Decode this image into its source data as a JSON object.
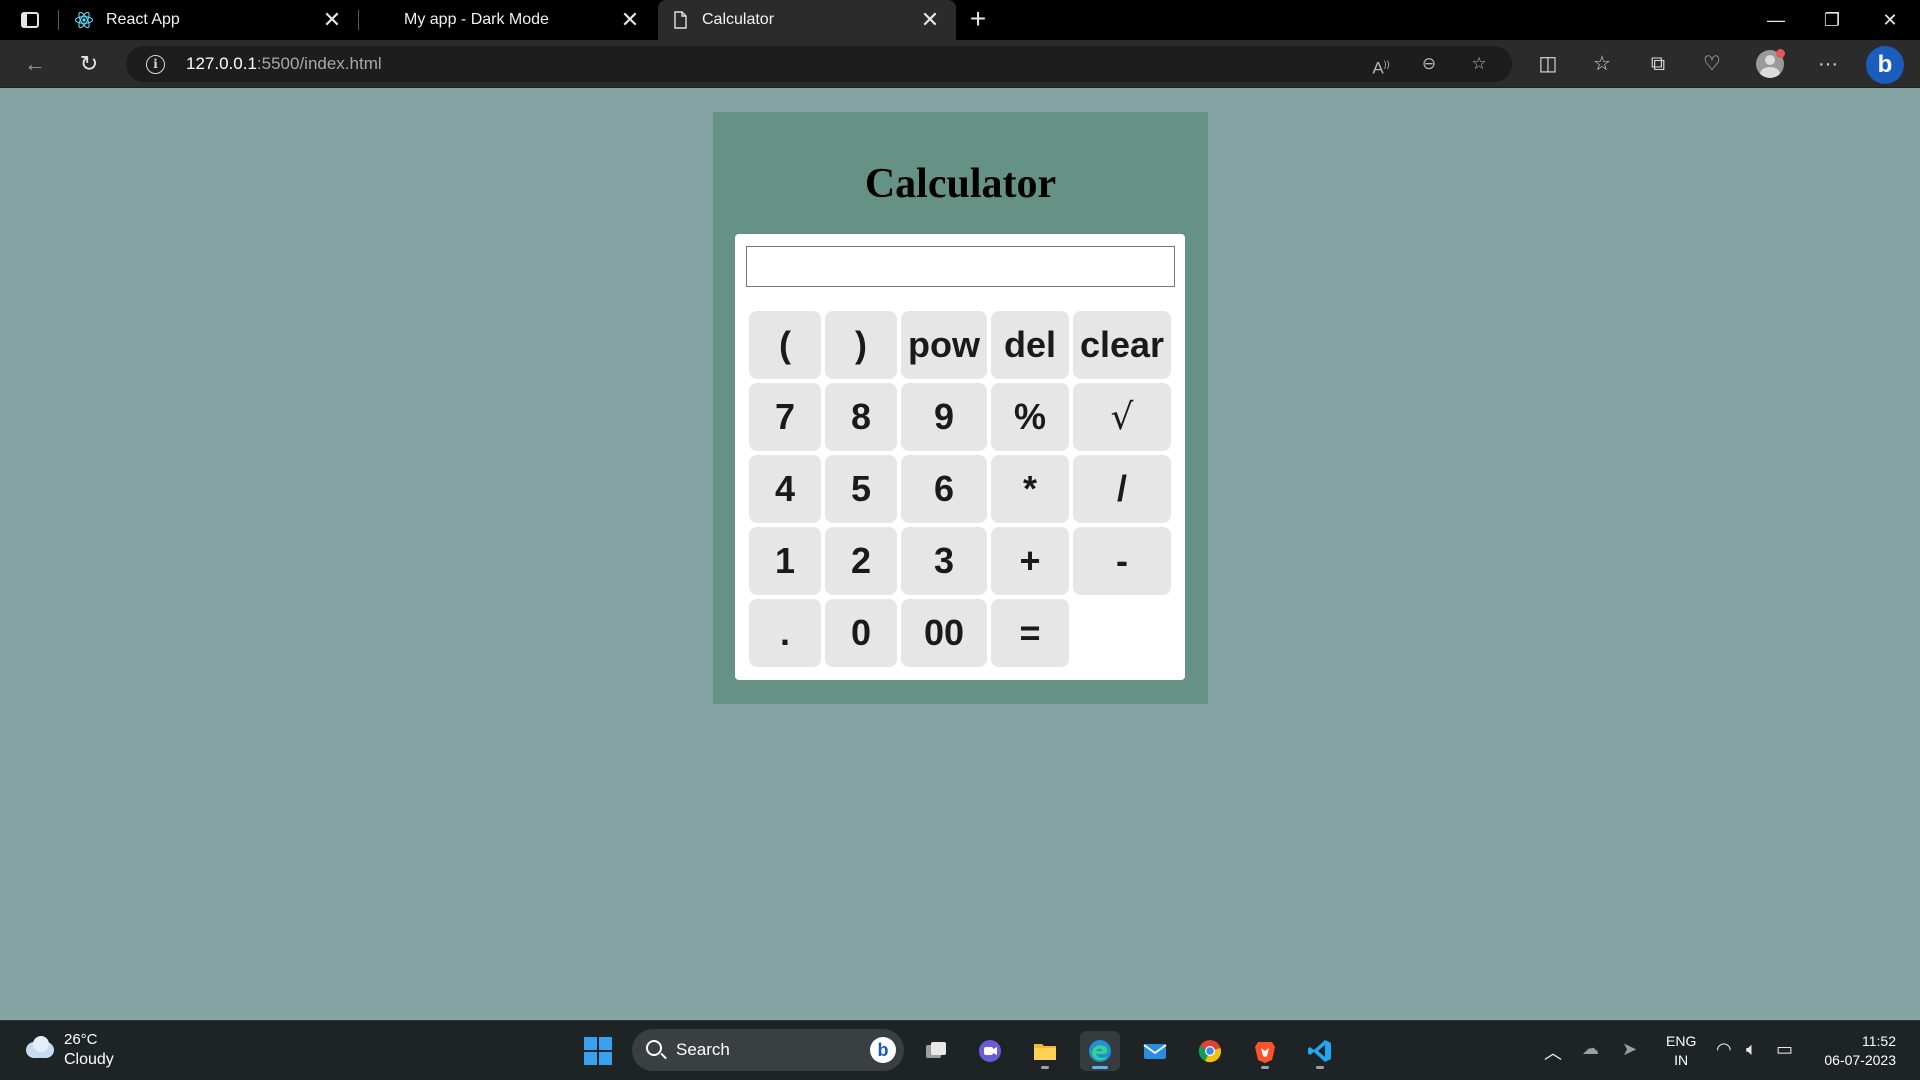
{
  "browser": {
    "tabs": [
      {
        "title": "React App"
      },
      {
        "title": "My app - Dark Mode"
      },
      {
        "title": "Calculator"
      }
    ],
    "new_tab_icon": "plus-icon",
    "address": {
      "host": "127.0.0.1",
      "rest": ":5500/index.html"
    }
  },
  "calculator": {
    "title": "Calculator",
    "display_value": "",
    "keys": [
      "(",
      ")",
      "pow",
      "del",
      "clear",
      "7",
      "8",
      "9",
      "%",
      "√",
      "4",
      "5",
      "6",
      "*",
      "/",
      "1",
      "2",
      "3",
      "+",
      "-",
      ".",
      "0",
      "00",
      "="
    ]
  },
  "taskbar": {
    "weather": {
      "temp": "26°C",
      "desc": "Cloudy"
    },
    "search_label": "Search",
    "lang": {
      "line1": "ENG",
      "line2": "IN"
    },
    "clock": {
      "time": "11:52",
      "date": "06-07-2023"
    }
  },
  "colors": {
    "page_bg": "#86a4a4",
    "calc_bg": "#659284",
    "key_bg": "#e6e6e6",
    "accent": "#1b5dbd"
  }
}
